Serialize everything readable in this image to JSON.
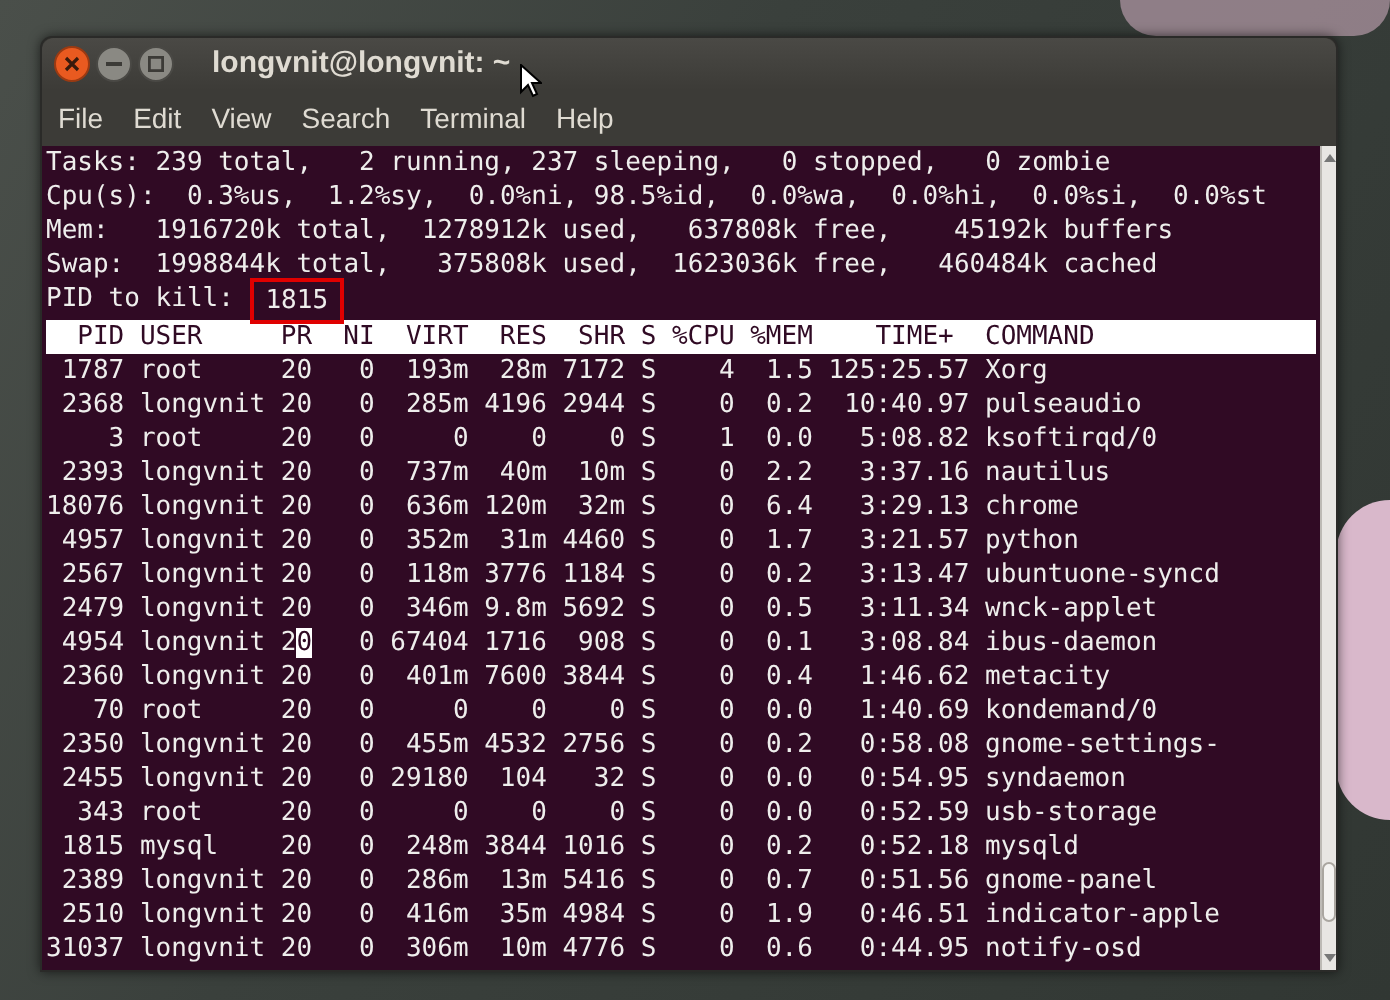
{
  "window": {
    "title": "longvnit@longvnit: ~"
  },
  "menu": [
    "File",
    "Edit",
    "View",
    "Search",
    "Terminal",
    "Help"
  ],
  "summary": [
    "Tasks: 239 total,   2 running, 237 sleeping,   0 stopped,   0 zombie",
    "Cpu(s):  0.3%us,  1.2%sy,  0.0%ni, 98.5%id,  0.0%wa,  0.0%hi,  0.0%si,  0.0%st",
    "Mem:   1916720k total,  1278912k used,   637808k free,    45192k buffers",
    "Swap:  1998844k total,   375808k used,  1623036k free,   460484k cached"
  ],
  "prompt": {
    "label": "PID to kill:",
    "value": "1815",
    "highlighted": true
  },
  "table": {
    "columns": [
      "PID",
      "USER",
      "PR",
      "NI",
      "VIRT",
      "RES",
      "SHR",
      "S",
      "%CPU",
      "%MEM",
      "TIME+",
      "COMMAND"
    ],
    "rows": [
      {
        "cells": [
          "1787",
          "root",
          "20",
          "0",
          "193m",
          "28m",
          "7172",
          "S",
          "4",
          "1.5",
          "125:25.57",
          "Xorg"
        ],
        "cursor": false
      },
      {
        "cells": [
          "2368",
          "longvnit",
          "20",
          "0",
          "285m",
          "4196",
          "2944",
          "S",
          "0",
          "0.2",
          "10:40.97",
          "pulseaudio"
        ],
        "cursor": false
      },
      {
        "cells": [
          "3",
          "root",
          "20",
          "0",
          "0",
          "0",
          "0",
          "S",
          "1",
          "0.0",
          "5:08.82",
          "ksoftirqd/0"
        ],
        "cursor": false
      },
      {
        "cells": [
          "2393",
          "longvnit",
          "20",
          "0",
          "737m",
          "40m",
          "10m",
          "S",
          "0",
          "2.2",
          "3:37.16",
          "nautilus"
        ],
        "cursor": false
      },
      {
        "cells": [
          "18076",
          "longvnit",
          "20",
          "0",
          "636m",
          "120m",
          "32m",
          "S",
          "0",
          "6.4",
          "3:29.13",
          "chrome"
        ],
        "cursor": false
      },
      {
        "cells": [
          "4957",
          "longvnit",
          "20",
          "0",
          "352m",
          "31m",
          "4460",
          "S",
          "0",
          "1.7",
          "3:21.57",
          "python"
        ],
        "cursor": false
      },
      {
        "cells": [
          "2567",
          "longvnit",
          "20",
          "0",
          "118m",
          "3776",
          "1184",
          "S",
          "0",
          "0.2",
          "3:13.47",
          "ubuntuone-syncd"
        ],
        "cursor": false
      },
      {
        "cells": [
          "2479",
          "longvnit",
          "20",
          "0",
          "346m",
          "9.8m",
          "5692",
          "S",
          "0",
          "0.5",
          "3:11.34",
          "wnck-applet"
        ],
        "cursor": false
      },
      {
        "cells": [
          "4954",
          "longvnit",
          "20",
          "0",
          "67404",
          "1716",
          "908",
          "S",
          "0",
          "0.1",
          "3:08.84",
          "ibus-daemon"
        ],
        "cursor": true
      },
      {
        "cells": [
          "2360",
          "longvnit",
          "20",
          "0",
          "401m",
          "7600",
          "3844",
          "S",
          "0",
          "0.4",
          "1:46.62",
          "metacity"
        ],
        "cursor": false
      },
      {
        "cells": [
          "70",
          "root",
          "20",
          "0",
          "0",
          "0",
          "0",
          "S",
          "0",
          "0.0",
          "1:40.69",
          "kondemand/0"
        ],
        "cursor": false
      },
      {
        "cells": [
          "2350",
          "longvnit",
          "20",
          "0",
          "455m",
          "4532",
          "2756",
          "S",
          "0",
          "0.2",
          "0:58.08",
          "gnome-settings-"
        ],
        "cursor": false
      },
      {
        "cells": [
          "2455",
          "longvnit",
          "20",
          "0",
          "29180",
          "104",
          "32",
          "S",
          "0",
          "0.0",
          "0:54.95",
          "syndaemon"
        ],
        "cursor": false
      },
      {
        "cells": [
          "343",
          "root",
          "20",
          "0",
          "0",
          "0",
          "0",
          "S",
          "0",
          "0.0",
          "0:52.59",
          "usb-storage"
        ],
        "cursor": false
      },
      {
        "cells": [
          "1815",
          "mysql",
          "20",
          "0",
          "248m",
          "3844",
          "1016",
          "S",
          "0",
          "0.2",
          "0:52.18",
          "mysqld"
        ],
        "cursor": false
      },
      {
        "cells": [
          "2389",
          "longvnit",
          "20",
          "0",
          "286m",
          "13m",
          "5416",
          "S",
          "0",
          "0.7",
          "0:51.56",
          "gnome-panel"
        ],
        "cursor": false
      },
      {
        "cells": [
          "2510",
          "longvnit",
          "20",
          "0",
          "416m",
          "35m",
          "4984",
          "S",
          "0",
          "1.9",
          "0:46.51",
          "indicator-apple"
        ],
        "cursor": false
      },
      {
        "cells": [
          "31037",
          "longvnit",
          "20",
          "0",
          "306m",
          "10m",
          "4776",
          "S",
          "0",
          "0.6",
          "0:44.95",
          "notify-osd"
        ],
        "cursor": false
      }
    ]
  }
}
